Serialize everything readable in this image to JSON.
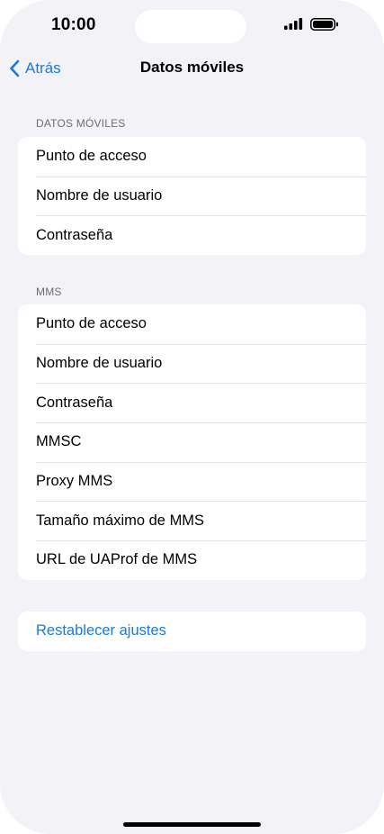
{
  "status_bar": {
    "time": "10:00"
  },
  "nav": {
    "back_label": "Atrás",
    "title": "Datos móviles"
  },
  "sections": {
    "datos_moviles": {
      "header": "DATOS MÓVILES",
      "items": [
        "Punto de acceso",
        "Nombre de usuario",
        "Contraseña"
      ]
    },
    "mms": {
      "header": "MMS",
      "items": [
        "Punto de acceso",
        "Nombre de usuario",
        "Contraseña",
        "MMSC",
        "Proxy MMS",
        "Tamaño máximo de MMS",
        "URL de UAProf de MMS"
      ]
    },
    "reset": {
      "label": "Restablecer ajustes"
    }
  },
  "colors": {
    "accent": "#1a7ad6",
    "background": "#f2f2f7"
  },
  "icons": [
    "signal-icon",
    "battery-icon",
    "chevron-left-icon"
  ]
}
